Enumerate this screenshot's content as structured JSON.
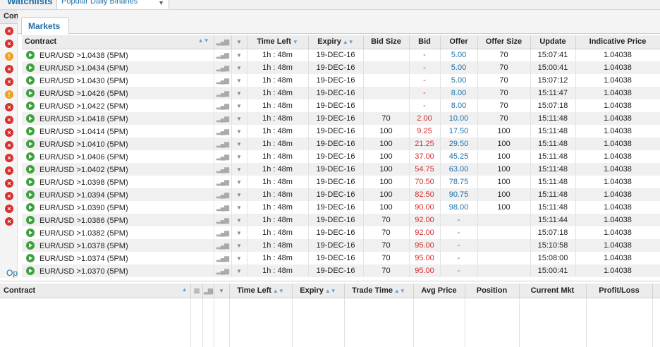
{
  "topbar": {
    "watchlists_label": "Watchlists",
    "watchlist_select": "Popular Daily Binaries"
  },
  "leftstrip": {
    "header": "Contract",
    "statuses": [
      "error",
      "error",
      "warning",
      "error",
      "error",
      "warning",
      "error",
      "error",
      "error",
      "error",
      "error",
      "error",
      "error",
      "error",
      "error",
      "error"
    ],
    "bottom_tab": "Op"
  },
  "markets": {
    "tab_label": "Markets",
    "columns": {
      "contract": "Contract",
      "time_left": "Time Left",
      "expiry": "Expiry",
      "bid_size": "Bid Size",
      "bid": "Bid",
      "offer": "Offer",
      "offer_size": "Offer Size",
      "update": "Update",
      "indicative": "Indicative Price"
    },
    "rows": [
      {
        "contract": "EUR/USD >1.0438 (5PM)",
        "time_left": "1h : 48m",
        "expiry": "19-DEC-16",
        "bid_size": "",
        "bid": "-",
        "offer": "5.00",
        "offer_size": "70",
        "update": "15:07:41",
        "indicative": "1.04038"
      },
      {
        "contract": "EUR/USD >1.0434 (5PM)",
        "time_left": "1h : 48m",
        "expiry": "19-DEC-16",
        "bid_size": "",
        "bid": "-",
        "offer": "5.00",
        "offer_size": "70",
        "update": "15:00:41",
        "indicative": "1.04038"
      },
      {
        "contract": "EUR/USD >1.0430 (5PM)",
        "time_left": "1h : 48m",
        "expiry": "19-DEC-16",
        "bid_size": "",
        "bid": "-",
        "offer": "5.00",
        "offer_size": "70",
        "update": "15:07:12",
        "indicative": "1.04038"
      },
      {
        "contract": "EUR/USD >1.0426 (5PM)",
        "time_left": "1h : 48m",
        "expiry": "19-DEC-16",
        "bid_size": "",
        "bid": "-",
        "offer": "8.00",
        "offer_size": "70",
        "update": "15:11:47",
        "indicative": "1.04038"
      },
      {
        "contract": "EUR/USD >1.0422 (5PM)",
        "time_left": "1h : 48m",
        "expiry": "19-DEC-16",
        "bid_size": "",
        "bid": "-",
        "offer": "8.00",
        "offer_size": "70",
        "update": "15:07:18",
        "indicative": "1.04038"
      },
      {
        "contract": "EUR/USD >1.0418 (5PM)",
        "time_left": "1h : 48m",
        "expiry": "19-DEC-16",
        "bid_size": "70",
        "bid": "2.00",
        "offer": "10.00",
        "offer_size": "70",
        "update": "15:11:48",
        "indicative": "1.04038"
      },
      {
        "contract": "EUR/USD >1.0414 (5PM)",
        "time_left": "1h : 48m",
        "expiry": "19-DEC-16",
        "bid_size": "100",
        "bid": "9.25",
        "offer": "17.50",
        "offer_size": "100",
        "update": "15:11:48",
        "indicative": "1.04038"
      },
      {
        "contract": "EUR/USD >1.0410 (5PM)",
        "time_left": "1h : 48m",
        "expiry": "19-DEC-16",
        "bid_size": "100",
        "bid": "21.25",
        "offer": "29.50",
        "offer_size": "100",
        "update": "15:11:48",
        "indicative": "1.04038"
      },
      {
        "contract": "EUR/USD >1.0406 (5PM)",
        "time_left": "1h : 48m",
        "expiry": "19-DEC-16",
        "bid_size": "100",
        "bid": "37.00",
        "offer": "45.25",
        "offer_size": "100",
        "update": "15:11:48",
        "indicative": "1.04038"
      },
      {
        "contract": "EUR/USD >1.0402 (5PM)",
        "time_left": "1h : 48m",
        "expiry": "19-DEC-16",
        "bid_size": "100",
        "bid": "54.75",
        "offer": "63.00",
        "offer_size": "100",
        "update": "15:11:48",
        "indicative": "1.04038"
      },
      {
        "contract": "EUR/USD >1.0398 (5PM)",
        "time_left": "1h : 48m",
        "expiry": "19-DEC-16",
        "bid_size": "100",
        "bid": "70.50",
        "offer": "78.75",
        "offer_size": "100",
        "update": "15:11:48",
        "indicative": "1.04038"
      },
      {
        "contract": "EUR/USD >1.0394 (5PM)",
        "time_left": "1h : 48m",
        "expiry": "19-DEC-16",
        "bid_size": "100",
        "bid": "82.50",
        "offer": "90.75",
        "offer_size": "100",
        "update": "15:11:48",
        "indicative": "1.04038"
      },
      {
        "contract": "EUR/USD >1.0390 (5PM)",
        "time_left": "1h : 48m",
        "expiry": "19-DEC-16",
        "bid_size": "100",
        "bid": "90.00",
        "offer": "98.00",
        "offer_size": "100",
        "update": "15:11:48",
        "indicative": "1.04038"
      },
      {
        "contract": "EUR/USD >1.0386 (5PM)",
        "time_left": "1h : 48m",
        "expiry": "19-DEC-16",
        "bid_size": "70",
        "bid": "92.00",
        "offer": "-",
        "offer_size": "",
        "update": "15:11:44",
        "indicative": "1.04038"
      },
      {
        "contract": "EUR/USD >1.0382 (5PM)",
        "time_left": "1h : 48m",
        "expiry": "19-DEC-16",
        "bid_size": "70",
        "bid": "92.00",
        "offer": "-",
        "offer_size": "",
        "update": "15:07:18",
        "indicative": "1.04038"
      },
      {
        "contract": "EUR/USD >1.0378 (5PM)",
        "time_left": "1h : 48m",
        "expiry": "19-DEC-16",
        "bid_size": "70",
        "bid": "95.00",
        "offer": "-",
        "offer_size": "",
        "update": "15:10:58",
        "indicative": "1.04038"
      },
      {
        "contract": "EUR/USD >1.0374 (5PM)",
        "time_left": "1h : 48m",
        "expiry": "19-DEC-16",
        "bid_size": "70",
        "bid": "95.00",
        "offer": "-",
        "offer_size": "",
        "update": "15:08:00",
        "indicative": "1.04038"
      },
      {
        "contract": "EUR/USD >1.0370 (5PM)",
        "time_left": "1h : 48m",
        "expiry": "19-DEC-16",
        "bid_size": "70",
        "bid": "95.00",
        "offer": "-",
        "offer_size": "",
        "update": "15:00:41",
        "indicative": "1.04038"
      }
    ]
  },
  "positions": {
    "columns": {
      "contract": "Contract",
      "time_left": "Time Left",
      "expiry": "Expiry",
      "trade_time": "Trade Time",
      "avg_price": "Avg Price",
      "position": "Position",
      "current_mkt": "Current Mkt",
      "profit_loss": "Profit/Loss"
    }
  },
  "colors": {
    "accent": "#1f6fa8",
    "bid": "#d32f2f",
    "offer": "#1f6fa8",
    "error": "#d9302c",
    "warning": "#f0a020",
    "play": "#3fa03f"
  }
}
